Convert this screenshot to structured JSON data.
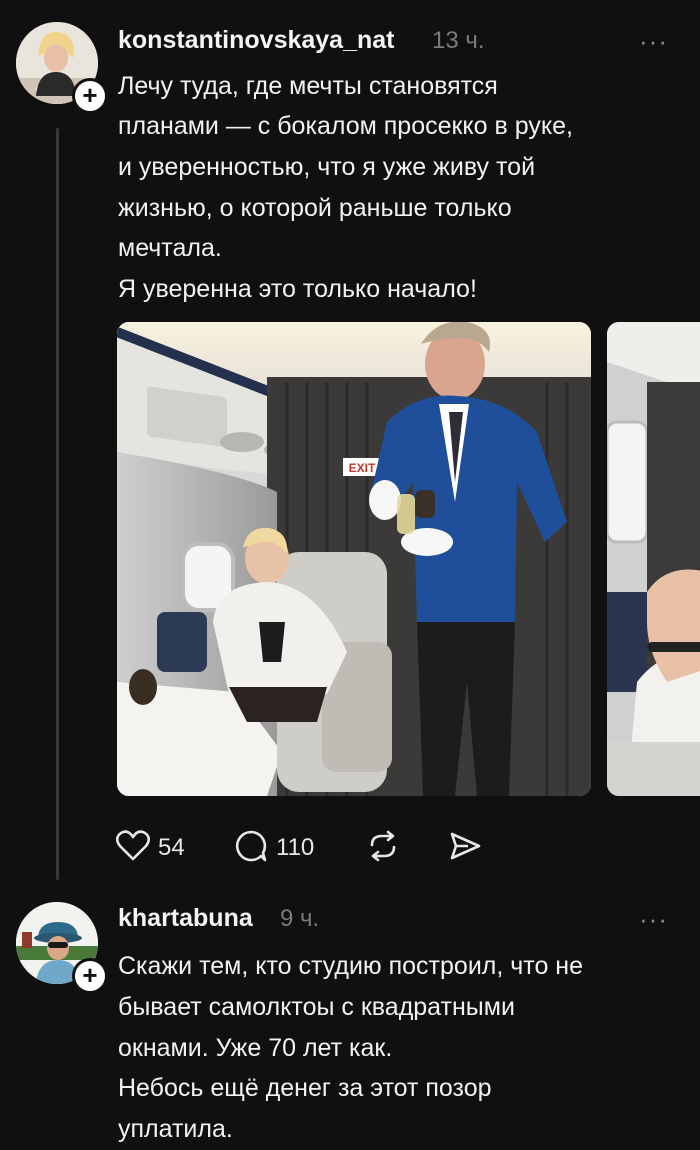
{
  "posts": [
    {
      "username": "konstantinovskaya_nat",
      "time": "13 ч.",
      "more": "···",
      "text_lines": [
        "Лечу туда, где мечты становятся",
        "планами — с бокалом просекко в руке,",
        "и уверенностью, что я уже живу той",
        "жизнью, о которой раньше только",
        "мечтала.",
        "Я уверенна это только начало!"
      ],
      "actions": {
        "likes": "54",
        "comments": "110"
      },
      "icons": [
        "heart-icon",
        "comment-icon",
        "repost-icon",
        "share-icon"
      ]
    },
    {
      "username": "khartabuna",
      "time": "9 ч.",
      "more": "···",
      "text_lines": [
        "Скажи тем,  кто студию построил, что не",
        "бывает самолктоы с квадратными",
        "окнами. Уже 70 лет как.",
        "Небось ещё денег за этот позор",
        "уплатила."
      ]
    }
  ],
  "photo": {
    "exit_sign": "EXIT"
  },
  "colors": {
    "background": "#101010",
    "muted": "#7a7a7a",
    "suit": "#1f4f9a"
  }
}
